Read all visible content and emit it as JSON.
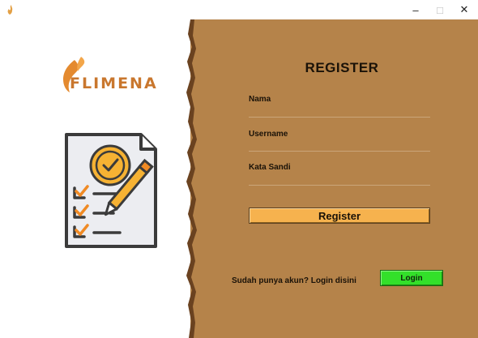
{
  "window": {
    "icon": "flame-icon",
    "minimize_glyph": "–",
    "maximize_glyph": "□",
    "close_glyph": "✕"
  },
  "brand": {
    "logo_text": "FLIMENA",
    "illustration": "checklist-document-with-pencil"
  },
  "form": {
    "title": "REGISTER",
    "fields": [
      {
        "label": "Nama",
        "value": ""
      },
      {
        "label": "Username",
        "value": ""
      },
      {
        "label": "Kata Sandi",
        "value": ""
      }
    ],
    "submit_label": "Register"
  },
  "footer": {
    "prompt": "Sudah punya akun? Login disini",
    "login_label": "Login"
  },
  "colors": {
    "panel_bg": "#b5834a",
    "register_button": "#f6b24e",
    "login_button": "#33e02a",
    "brand_orange": "#c9772e"
  }
}
